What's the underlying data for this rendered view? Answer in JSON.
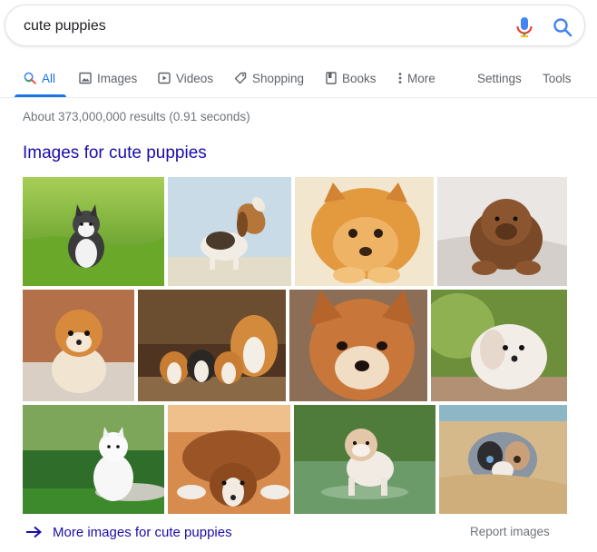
{
  "search": {
    "query": "cute puppies"
  },
  "tabs": [
    {
      "label": "All",
      "icon": "search-icon",
      "active": true
    },
    {
      "label": "Images",
      "icon": "image-icon"
    },
    {
      "label": "Videos",
      "icon": "video-icon"
    },
    {
      "label": "Shopping",
      "icon": "tag-icon"
    },
    {
      "label": "Books",
      "icon": "book-icon"
    },
    {
      "label": "More",
      "icon": "more-vert-icon"
    },
    {
      "label": "Settings"
    },
    {
      "label": "Tools"
    }
  ],
  "stats": "About 373,000,000 results (0.91 seconds)",
  "images_heading": "Images for cute puppies",
  "thumbnails": [
    {
      "subject": "husky puppy sitting in green grass"
    },
    {
      "subject": "beagle puppy howling"
    },
    {
      "subject": "fluffy orange pomeranian lying down"
    },
    {
      "subject": "brown chow chow puppy on white rug"
    },
    {
      "subject": "pomeranian puppy (Boo)"
    },
    {
      "subject": "three corgi puppies with adult corgi"
    },
    {
      "subject": "shiba inu puppy face"
    },
    {
      "subject": "white maltese puppy"
    },
    {
      "subject": "white samoyed puppy on grass"
    },
    {
      "subject": "puppy lying flat on wooden floor"
    },
    {
      "subject": "bulldog puppy in water"
    },
    {
      "subject": "australian shepherd puppy in sand"
    }
  ],
  "footer": {
    "more_images": "More images for cute puppies",
    "report": "Report images"
  },
  "colors": {
    "link": "#1a0dab",
    "accent": "#1a73e8",
    "muted": "#70757a"
  }
}
